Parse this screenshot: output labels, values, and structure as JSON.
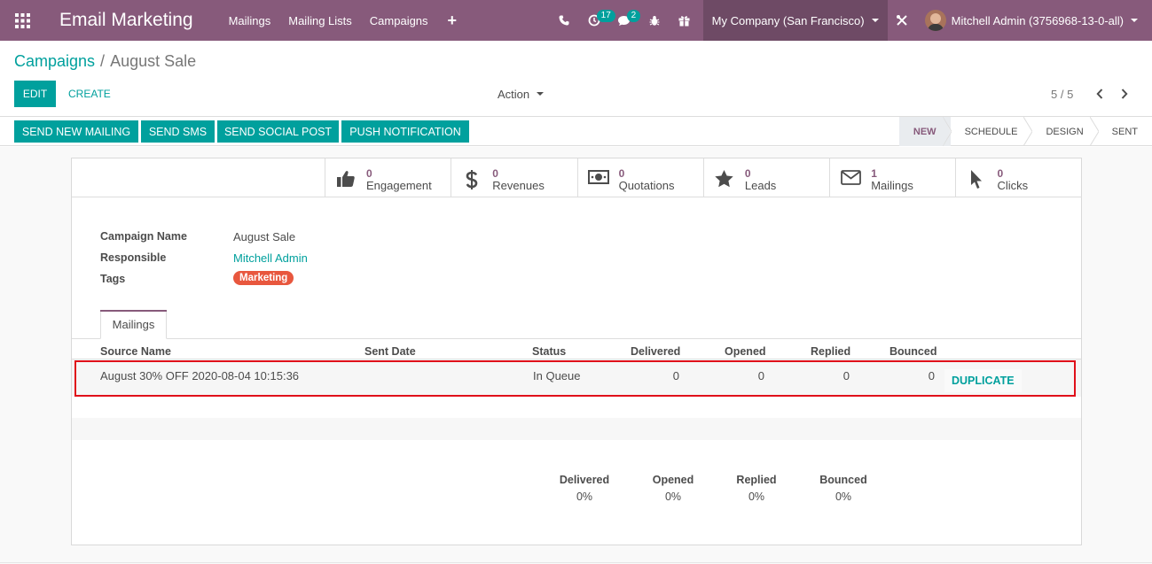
{
  "navbar": {
    "app_title": "Email Marketing",
    "menu": [
      "Mailings",
      "Mailing Lists",
      "Campaigns"
    ],
    "activity_badge": "17",
    "messages_badge": "2",
    "company": "My Company (San Francisco)",
    "user": "Mitchell Admin (3756968-13-0-all)",
    "colors": {
      "bar": "#875a7b",
      "company_bg": "#6e4a65",
      "badge": "#00a09d"
    }
  },
  "breadcrumb": {
    "parent": "Campaigns",
    "current": "August Sale"
  },
  "control": {
    "edit_label": "EDIT",
    "create_label": "CREATE",
    "action_label": "Action",
    "pager": "5 / 5"
  },
  "statusbar": {
    "buttons": [
      "SEND NEW MAILING",
      "SEND SMS",
      "SEND SOCIAL POST",
      "PUSH NOTIFICATION"
    ],
    "stages": [
      "NEW",
      "SCHEDULE",
      "DESIGN",
      "SENT"
    ],
    "active_stage": "NEW"
  },
  "stats": [
    {
      "value": "0",
      "label": "Engagement",
      "icon": "thumbs-up-icon"
    },
    {
      "value": "0",
      "label": "Revenues",
      "icon": "dollar-icon"
    },
    {
      "value": "0",
      "label": "Quotations",
      "icon": "money-bill-icon"
    },
    {
      "value": "0",
      "label": "Leads",
      "icon": "star-icon"
    },
    {
      "value": "1",
      "label": "Mailings",
      "icon": "envelope-icon"
    },
    {
      "value": "0",
      "label": "Clicks",
      "icon": "cursor-icon"
    }
  ],
  "form": {
    "campaign_name_label": "Campaign Name",
    "campaign_name": "August Sale",
    "responsible_label": "Responsible",
    "responsible": "Mitchell Admin",
    "tags_label": "Tags",
    "tag": "Marketing",
    "tag_color": "#e8573e"
  },
  "tab": {
    "label": "Mailings"
  },
  "table": {
    "headers": [
      "Source Name",
      "Sent Date",
      "Status",
      "Delivered",
      "Opened",
      "Replied",
      "Bounced"
    ],
    "rows": [
      {
        "source": "August 30% OFF 2020-08-04 10:15:36",
        "sent_date": "",
        "status": "In Queue",
        "delivered": "0",
        "opened": "0",
        "replied": "0",
        "bounced": "0",
        "action": "DUPLICATE"
      }
    ]
  },
  "summary": {
    "labels": [
      "Delivered",
      "Opened",
      "Replied",
      "Bounced"
    ],
    "values": [
      "0%",
      "0%",
      "0%",
      "0%"
    ]
  }
}
